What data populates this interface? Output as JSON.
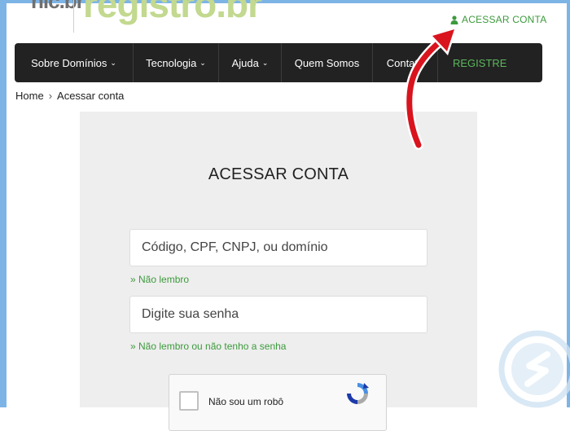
{
  "header": {
    "logo_nic": "nic.br",
    "logo_registro": "registro.br",
    "account_link": "ACESSAR CONTA"
  },
  "nav": {
    "items": [
      {
        "label": "Sobre Domínios",
        "dropdown": true
      },
      {
        "label": "Tecnologia",
        "dropdown": true
      },
      {
        "label": "Ajuda",
        "dropdown": true
      },
      {
        "label": "Quem Somos",
        "dropdown": false
      },
      {
        "label": "Contato",
        "dropdown": false
      },
      {
        "label": "REGISTRE",
        "dropdown": false
      }
    ]
  },
  "breadcrumb": {
    "home": "Home",
    "separator": "›",
    "current": "Acessar conta"
  },
  "login": {
    "title": "ACESSAR CONTA",
    "code_placeholder": "Código, CPF, CNPJ, ou domínio",
    "forgot_code": "» Não lembro",
    "password_placeholder": "Digite sua senha",
    "forgot_password": "» Não lembro ou não tenho a senha"
  },
  "captcha": {
    "label": "Não sou um robô"
  },
  "icons": {
    "user": "user-icon",
    "chevron": "chevron-down-icon",
    "recaptcha": "recaptcha-logo-icon",
    "arrow": "red-arrow-annotation",
    "watermark": "watermark-logo"
  },
  "colors": {
    "accent_green": "#3c9a3c",
    "nav_bg": "#222222",
    "panel_bg": "#eeeeee",
    "arrow_red": "#d9141e",
    "logo_green": "#c2d98f"
  }
}
